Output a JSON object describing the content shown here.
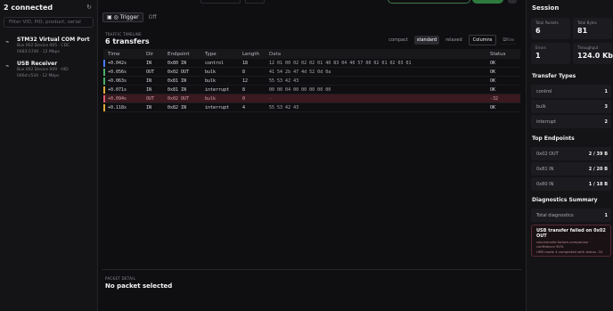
{
  "left": {
    "title": "2 connected",
    "filter_placeholder": "Filter VID, PID, product, serial",
    "devices": [
      {
        "name": "STM32 Virtual COM Port",
        "meta1": "Bus 002 Device 005 · CDC",
        "meta2": "0483:5740 · 12 Mbps"
      },
      {
        "name": "USB Receiver",
        "meta1": "Bus 002 Device 009 · HID",
        "meta2": "046d:c534 · 12 Mbps"
      }
    ]
  },
  "toolbar": {
    "trigger": "Trigger",
    "off": "Off"
  },
  "timeline": {
    "label": "TRAFFIC TIMELINE",
    "title": "6 transfers",
    "views": [
      "compact",
      "standard",
      "relaxed"
    ],
    "active_view": "standard",
    "columns_label": "Columns",
    "row_label": "Row"
  },
  "table": {
    "headers": [
      "Time",
      "Dir",
      "Endpoint",
      "Type",
      "Length",
      "Data",
      "Status"
    ],
    "rows": [
      {
        "time": "+0.042s",
        "dir": "IN",
        "ep": "0x80 IN",
        "type": "control",
        "len": "18",
        "data": "12 01 00 02 02 02 01 40 83 04 40 57 00 02 01 02 03 01",
        "status": "OK",
        "marker": "#4a7dff"
      },
      {
        "time": "+0.056s",
        "dir": "OUT",
        "ep": "0x02 OUT",
        "type": "bulk",
        "len": "8",
        "data": "41 54 2b 47 4d 52 0d 0a",
        "status": "OK",
        "marker": "#4caf6a"
      },
      {
        "time": "+0.063s",
        "dir": "IN",
        "ep": "0x81 IN",
        "type": "bulk",
        "len": "12",
        "data": "55 53 42 43",
        "status": "OK",
        "marker": "#4caf6a"
      },
      {
        "time": "+0.071s",
        "dir": "IN",
        "ep": "0x81 IN",
        "type": "interrupt",
        "len": "8",
        "data": "00 00 04 00 00 00 00 00",
        "status": "OK",
        "marker": "#e0a93a"
      },
      {
        "time": "+0.094s",
        "dir": "OUT",
        "ep": "0x02 OUT",
        "type": "bulk",
        "len": "0",
        "data": "-",
        "status": "-32",
        "marker": "#e05a6a",
        "error": true
      },
      {
        "time": "+0.118s",
        "dir": "IN",
        "ep": "0x82 IN",
        "type": "interrupt",
        "len": "4",
        "data": "55 53 42 43",
        "status": "OK",
        "marker": "#e0a93a"
      }
    ]
  },
  "packet_detail": {
    "label": "PACKET DETAIL",
    "title": "No packet selected"
  },
  "session": {
    "title": "Session",
    "stats": [
      {
        "label": "Total Packets",
        "value": "6"
      },
      {
        "label": "Total Bytes",
        "value": "81"
      },
      {
        "label": "Errors",
        "value": "1"
      },
      {
        "label": "Throughput",
        "value": "124.0 Kb..."
      }
    ],
    "transfer_types_title": "Transfer Types",
    "transfer_types": [
      {
        "k": "control",
        "v": "1"
      },
      {
        "k": "bulk",
        "v": "3"
      },
      {
        "k": "interrupt",
        "v": "2"
      }
    ],
    "top_endpoints_title": "Top Endpoints",
    "top_endpoints": [
      {
        "k": "0x02 OUT",
        "v": "2 / 39 B"
      },
      {
        "k": "0x81 IN",
        "v": "2 / 20 B"
      },
      {
        "k": "0x80 IN",
        "v": "1 / 18 B"
      }
    ],
    "diag_title": "Diagnostics Summary",
    "diag_total_label": "Total diagnostics",
    "diag_total": "1",
    "diag_card": {
      "title": "USB transfer failed on 0x02 OUT",
      "line1": "usb.transfer.failure-companion · confidence 90%",
      "line2": "URB mode 4 completed with status -32"
    }
  }
}
